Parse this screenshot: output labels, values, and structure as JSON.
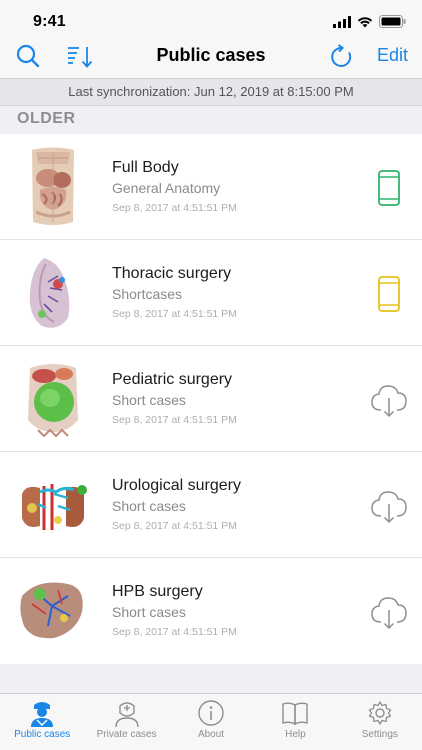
{
  "status": {
    "time": "9:41"
  },
  "nav": {
    "title": "Public cases",
    "edit_label": "Edit"
  },
  "sync": {
    "text": "Last synchronization: Jun 12, 2019 at 8:15:00 PM"
  },
  "section": {
    "header": "OLDER"
  },
  "cases": [
    {
      "title": "Full Body",
      "subtitle": "General Anatomy",
      "date": "Sep 8, 2017 at 4:51:51 PM",
      "status_icon": "device-icon",
      "status_color": "#2fb36d",
      "thumb": "full-body-thumbnail"
    },
    {
      "title": "Thoracic surgery",
      "subtitle": "Shortcases",
      "date": "Sep 8, 2017 at 4:51:51 PM",
      "status_icon": "device-icon",
      "status_color": "#e8c11a",
      "thumb": "lung-thumbnail"
    },
    {
      "title": "Pediatric surgery",
      "subtitle": "Short cases",
      "date": "Sep 8, 2017 at 4:51:51 PM",
      "status_icon": "cloud-download-icon",
      "status_color": "#8e8e93",
      "thumb": "abdomen-thumbnail"
    },
    {
      "title": "Urological surgery",
      "subtitle": "Short cases",
      "date": "Sep 8, 2017 at 4:51:51 PM",
      "status_icon": "cloud-download-icon",
      "status_color": "#8e8e93",
      "thumb": "kidney-thumbnail"
    },
    {
      "title": "HPB surgery",
      "subtitle": "Short cases",
      "date": "Sep 8, 2017 at 4:51:51 PM",
      "status_icon": "cloud-download-icon",
      "status_color": "#8e8e93",
      "thumb": "liver-thumbnail"
    }
  ],
  "tabs": [
    {
      "label": "Public cases",
      "icon": "doctor-icon",
      "active": true
    },
    {
      "label": "Private cases",
      "icon": "surgeon-icon",
      "active": false
    },
    {
      "label": "About",
      "icon": "info-icon",
      "active": false
    },
    {
      "label": "Help",
      "icon": "book-icon",
      "active": false
    },
    {
      "label": "Settings",
      "icon": "gear-icon",
      "active": false
    }
  ],
  "colors": {
    "accent": "#1a86e8",
    "green": "#2fb36d",
    "yellow": "#e8c11a",
    "gray": "#8e8e93"
  }
}
